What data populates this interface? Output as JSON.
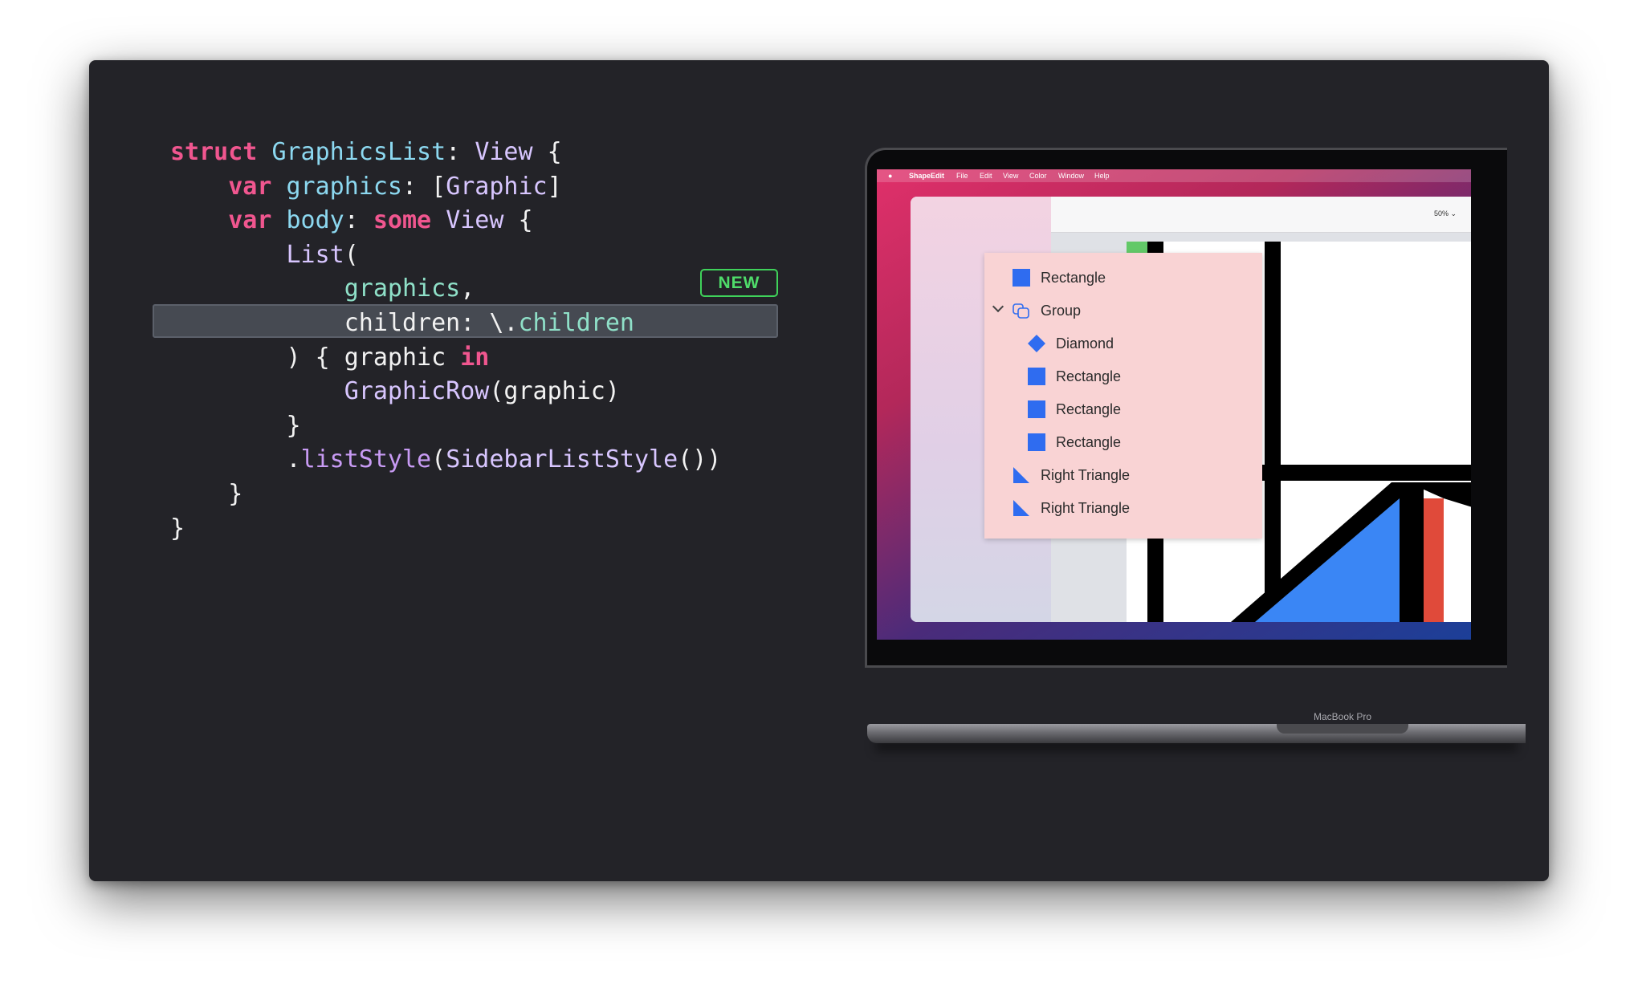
{
  "code": {
    "lines": [
      [
        {
          "t": "struct",
          "c": "kw"
        },
        {
          "t": " ",
          "c": ""
        },
        {
          "t": "GraphicsList",
          "c": "def"
        },
        {
          "t": ": ",
          "c": ""
        },
        {
          "t": "View",
          "c": "ty"
        },
        {
          "t": " {",
          "c": ""
        }
      ],
      [
        {
          "t": "    ",
          "c": ""
        },
        {
          "t": "var",
          "c": "kw"
        },
        {
          "t": " ",
          "c": ""
        },
        {
          "t": "graphics",
          "c": "def"
        },
        {
          "t": ": [",
          "c": ""
        },
        {
          "t": "Graphic",
          "c": "ty"
        },
        {
          "t": "]",
          "c": ""
        }
      ],
      [
        {
          "t": "    ",
          "c": ""
        },
        {
          "t": "var",
          "c": "kw"
        },
        {
          "t": " ",
          "c": ""
        },
        {
          "t": "body",
          "c": "def"
        },
        {
          "t": ": ",
          "c": ""
        },
        {
          "t": "some",
          "c": "kw"
        },
        {
          "t": " ",
          "c": ""
        },
        {
          "t": "View",
          "c": "ty"
        },
        {
          "t": " {",
          "c": ""
        }
      ],
      [
        {
          "t": "        ",
          "c": ""
        },
        {
          "t": "List",
          "c": "ty"
        },
        {
          "t": "(",
          "c": ""
        }
      ],
      [
        {
          "t": "            ",
          "c": ""
        },
        {
          "t": "graphics",
          "c": "prop"
        },
        {
          "t": ",",
          "c": ""
        }
      ],
      [
        {
          "t": "            ",
          "c": ""
        },
        {
          "t": "children: \\.",
          "c": ""
        },
        {
          "t": "children",
          "c": "prop"
        }
      ],
      [
        {
          "t": "        ",
          "c": ""
        },
        {
          "t": ") { graphic ",
          "c": ""
        },
        {
          "t": "in",
          "c": "kw"
        }
      ],
      [
        {
          "t": "            ",
          "c": ""
        },
        {
          "t": "GraphicRow",
          "c": "ty"
        },
        {
          "t": "(graphic)",
          "c": ""
        }
      ],
      [
        {
          "t": "        ",
          "c": ""
        },
        {
          "t": "}",
          "c": ""
        }
      ],
      [
        {
          "t": "        .",
          "c": ""
        },
        {
          "t": "listStyle",
          "c": "fn"
        },
        {
          "t": "(",
          "c": ""
        },
        {
          "t": "SidebarListStyle",
          "c": "ty"
        },
        {
          "t": "())",
          "c": ""
        }
      ],
      [
        {
          "t": "    ",
          "c": ""
        },
        {
          "t": "}",
          "c": ""
        }
      ],
      [
        {
          "t": "}",
          "c": ""
        }
      ]
    ],
    "highlighted_line": 5
  },
  "badge": {
    "label": "NEW"
  },
  "mac": {
    "menubar": [
      "ShapeEdit",
      "File",
      "Edit",
      "View",
      "Color",
      "Window",
      "Help"
    ],
    "zoom": "50% ⌄",
    "device_label": "MacBook Pro"
  },
  "popup": {
    "items": [
      {
        "label": "Rectangle",
        "icon": "square-icon",
        "indent": 0
      },
      {
        "label": "Group",
        "icon": "group-icon",
        "indent": 0,
        "expanded": true
      },
      {
        "label": "Diamond",
        "icon": "diamond-icon",
        "indent": 1
      },
      {
        "label": "Rectangle",
        "icon": "square-icon",
        "indent": 1
      },
      {
        "label": "Rectangle",
        "icon": "square-icon",
        "indent": 1
      },
      {
        "label": "Rectangle",
        "icon": "square-icon",
        "indent": 1
      },
      {
        "label": "Right Triangle",
        "icon": "triangle-icon",
        "indent": 0
      },
      {
        "label": "Right Triangle",
        "icon": "triangle-icon",
        "indent": 0
      }
    ]
  },
  "colors": {
    "accent_blue": "#2f6cf0",
    "green": "#62c968",
    "red": "#e04a3a",
    "new_badge": "#3fd15a"
  }
}
